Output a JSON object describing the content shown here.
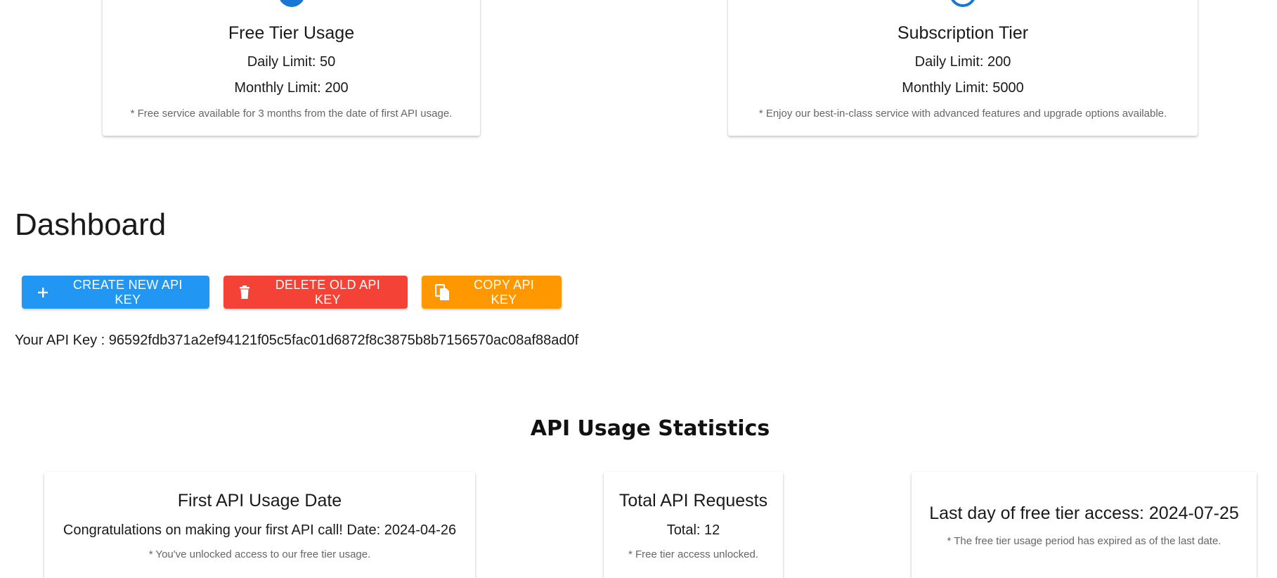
{
  "tiers": {
    "free": {
      "title": "Free Tier Usage",
      "daily": "Daily Limit: 50",
      "monthly": "Monthly Limit: 200",
      "note": "* Free service available for 3 months from the date of first API usage.",
      "icon": "circle-icon"
    },
    "subscription": {
      "title": "Subscription Tier",
      "daily": "Daily Limit: 200",
      "monthly": "Monthly Limit: 5000",
      "note": "* Enjoy our best-in-class service with advanced features and upgrade options available.",
      "icon": "ring-icon"
    }
  },
  "dashboard": {
    "title": "Dashboard",
    "buttons": {
      "create": {
        "label": "CREATE NEW API KEY",
        "icon": "plus-icon",
        "color": "#2196f3"
      },
      "delete": {
        "label": "DELETE OLD API KEY",
        "icon": "trash-icon",
        "color": "#f44336"
      },
      "copy": {
        "label": "COPY API KEY",
        "icon": "copy-icon",
        "color": "#ff9800"
      }
    },
    "api_key_line": "Your API Key : 96592fdb371a2ef94121f05c5fac01d6872f8c3875b8b7156570ac08af88ad0f"
  },
  "stats": {
    "title": "API Usage Statistics",
    "first_usage": {
      "heading": "First API Usage Date",
      "body": "Congratulations on making your first API call! Date: 2024-04-26",
      "note": "* You've unlocked access to our free tier usage."
    },
    "total_requests": {
      "heading": "Total API Requests",
      "body": "Total: 12",
      "note": "* Free tier access unlocked."
    },
    "last_day": {
      "heading": "Last day of free tier access: 2024-07-25",
      "note": "* The free tier usage period has expired as of the last date."
    }
  },
  "colors": {
    "accent": "#1976d2"
  }
}
